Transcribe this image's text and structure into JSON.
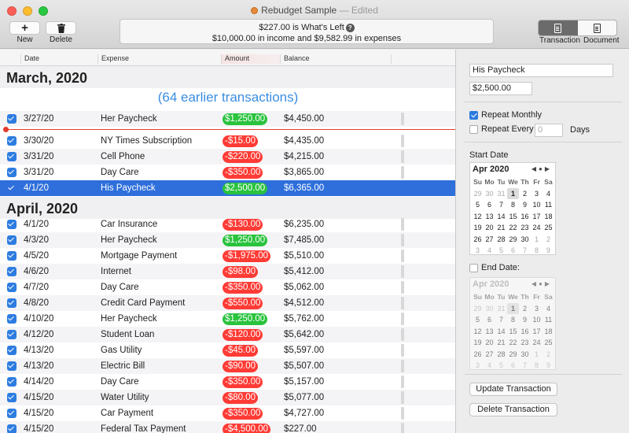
{
  "window": {
    "title": "Rebudget Sample",
    "status": "— Edited"
  },
  "toolbar": {
    "new_label": "New",
    "delete_label": "Delete",
    "summary_line1": "$227.00 is What's Left",
    "summary_line2": "$10,000.00 in income and $9,582.99 in expenses",
    "transaction_label": "Transaction",
    "document_label": "Document"
  },
  "table": {
    "columns": [
      "Date",
      "Expense",
      "Amount",
      "Balance"
    ],
    "month1": "March, 2020",
    "earlier": "(64 earlier transactions)",
    "month2": "April, 2020",
    "march_rows": [
      {
        "date": "3/27/20",
        "expense": "Her Paycheck",
        "amount": "$1,250.00",
        "kind": "pos",
        "balance": "$4,450.00"
      },
      {
        "date": "3/30/20",
        "expense": "NY Times Subscription",
        "amount": "-$15.00",
        "kind": "neg",
        "balance": "$4,435.00"
      },
      {
        "date": "3/31/20",
        "expense": "Cell Phone",
        "amount": "-$220.00",
        "kind": "neg",
        "balance": "$4,215.00"
      },
      {
        "date": "3/31/20",
        "expense": "Day Care",
        "amount": "-$350.00",
        "kind": "neg",
        "balance": "$3,865.00"
      },
      {
        "date": "4/1/20",
        "expense": "His Paycheck",
        "amount": "$2,500.00",
        "kind": "pos",
        "balance": "$6,365.00"
      }
    ],
    "april_rows": [
      {
        "date": "4/1/20",
        "expense": "Car Insurance",
        "amount": "-$130.00",
        "kind": "neg",
        "balance": "$6,235.00"
      },
      {
        "date": "4/3/20",
        "expense": "Her Paycheck",
        "amount": "$1,250.00",
        "kind": "pos",
        "balance": "$7,485.00"
      },
      {
        "date": "4/5/20",
        "expense": "Mortgage Payment",
        "amount": "-$1,975.00",
        "kind": "neg",
        "balance": "$5,510.00"
      },
      {
        "date": "4/6/20",
        "expense": "Internet",
        "amount": "-$98.00",
        "kind": "neg",
        "balance": "$5,412.00"
      },
      {
        "date": "4/7/20",
        "expense": "Day Care",
        "amount": "-$350.00",
        "kind": "neg",
        "balance": "$5,062.00"
      },
      {
        "date": "4/8/20",
        "expense": "Credit Card Payment",
        "amount": "-$550.00",
        "kind": "neg",
        "balance": "$4,512.00"
      },
      {
        "date": "4/10/20",
        "expense": "Her Paycheck",
        "amount": "$1,250.00",
        "kind": "pos",
        "balance": "$5,762.00"
      },
      {
        "date": "4/12/20",
        "expense": "Student Loan",
        "amount": "-$120.00",
        "kind": "neg",
        "balance": "$5,642.00"
      },
      {
        "date": "4/13/20",
        "expense": "Gas Utility",
        "amount": "-$45.00",
        "kind": "neg",
        "balance": "$5,597.00"
      },
      {
        "date": "4/13/20",
        "expense": "Electric Bill",
        "amount": "-$90.00",
        "kind": "neg",
        "balance": "$5,507.00"
      },
      {
        "date": "4/14/20",
        "expense": "Day Care",
        "amount": "-$350.00",
        "kind": "neg",
        "balance": "$5,157.00"
      },
      {
        "date": "4/15/20",
        "expense": "Water Utility",
        "amount": "-$80.00",
        "kind": "neg",
        "balance": "$5,077.00"
      },
      {
        "date": "4/15/20",
        "expense": "Car Payment",
        "amount": "-$350.00",
        "kind": "neg",
        "balance": "$4,727.00"
      },
      {
        "date": "4/15/20",
        "expense": "Federal Tax Payment",
        "amount": "-$4,500.00",
        "kind": "neg",
        "balance": "$227.00"
      }
    ]
  },
  "detail": {
    "name_value": "His Paycheck",
    "amount_value": "$2,500.00",
    "repeat_monthly": "Repeat Monthly",
    "repeat_every": "Repeat Every",
    "repeat_every_placeholder": "0",
    "days": "Days",
    "start_date": "Start Date",
    "end_date": "End Date:",
    "update_button": "Update Transaction",
    "delete_button": "Delete Transaction",
    "calendar_month": "Apr 2020",
    "dow": [
      "Su",
      "Mo",
      "Tu",
      "We",
      "Th",
      "Fr",
      "Sa"
    ],
    "days_grid": [
      [
        "29",
        "30",
        "31",
        "1",
        "2",
        "3",
        "4"
      ],
      [
        "5",
        "6",
        "7",
        "8",
        "9",
        "10",
        "11"
      ],
      [
        "12",
        "13",
        "14",
        "15",
        "16",
        "17",
        "18"
      ],
      [
        "19",
        "20",
        "21",
        "22",
        "23",
        "24",
        "25"
      ],
      [
        "26",
        "27",
        "28",
        "29",
        "30",
        "1",
        "2"
      ],
      [
        "3",
        "4",
        "5",
        "6",
        "7",
        "8",
        "9"
      ]
    ]
  },
  "colors": {
    "negative": "#ff3b35",
    "positive": "#29c33d",
    "selection": "#2e6fdb",
    "accent": "#3b8de0"
  }
}
